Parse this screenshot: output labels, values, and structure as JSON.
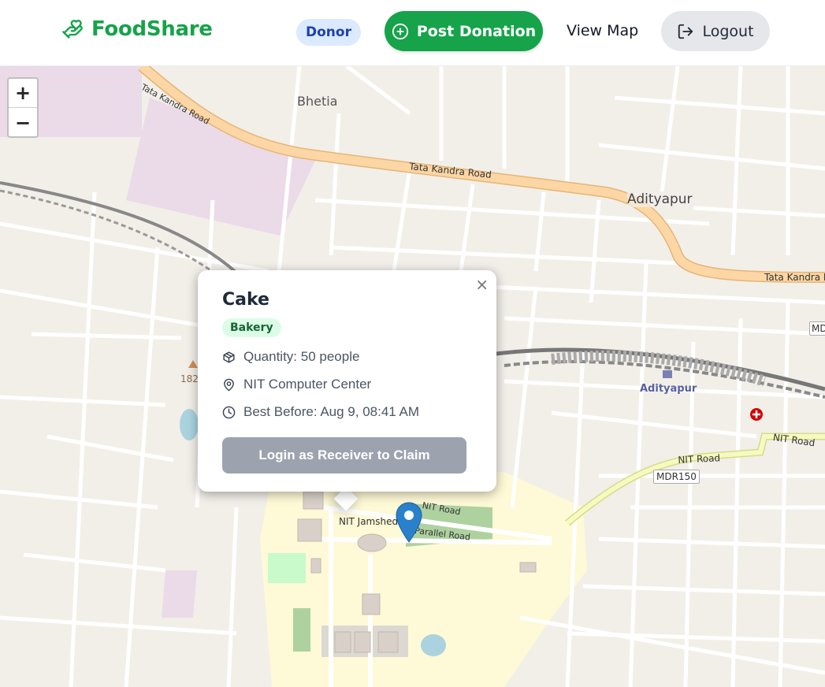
{
  "header": {
    "brand": "FoodShare",
    "role_badge": "Donor",
    "post_button": "Post Donation",
    "view_map": "View Map",
    "logout": "Logout"
  },
  "map": {
    "zoom_in": "+",
    "zoom_out": "−",
    "labels": {
      "bhetia": "Bhetia",
      "tata_kandra_1": "Tata Kandra Road",
      "tata_kandra_2": "Tata Kandra Road",
      "tata_kandra_3": "Tata Kandra R",
      "adityapur_area": "Adityapur",
      "adityapur_station": "Adityapur",
      "nit_road_1": "NIT Road",
      "nit_road_2": "NIT Road",
      "nit_road_3": "NIT Road",
      "mdr150": "MDR150",
      "md": "MD",
      "nit_jamshed": "NIT Jamshed",
      "parallel_road": "Parallel Road",
      "elevation": "182"
    }
  },
  "popup": {
    "close": "×",
    "title": "Cake",
    "category": "Bakery",
    "quantity": "Quantity: 50 people",
    "location": "NIT Computer Center",
    "best_before": "Best Before: Aug 9, 08:41 AM",
    "claim_button": "Login as Receiver to Claim"
  },
  "colors": {
    "brand": "#16a34a",
    "badge_bg": "#dbeafe",
    "badge_text": "#1e40af",
    "claim_disabled": "#9ca3af",
    "map_bg": "#f2efe9",
    "major_road": "#fcd6a4",
    "campus": "#fef9d6",
    "industrial": "#ebdbe8",
    "marker": "#2a81cb"
  }
}
